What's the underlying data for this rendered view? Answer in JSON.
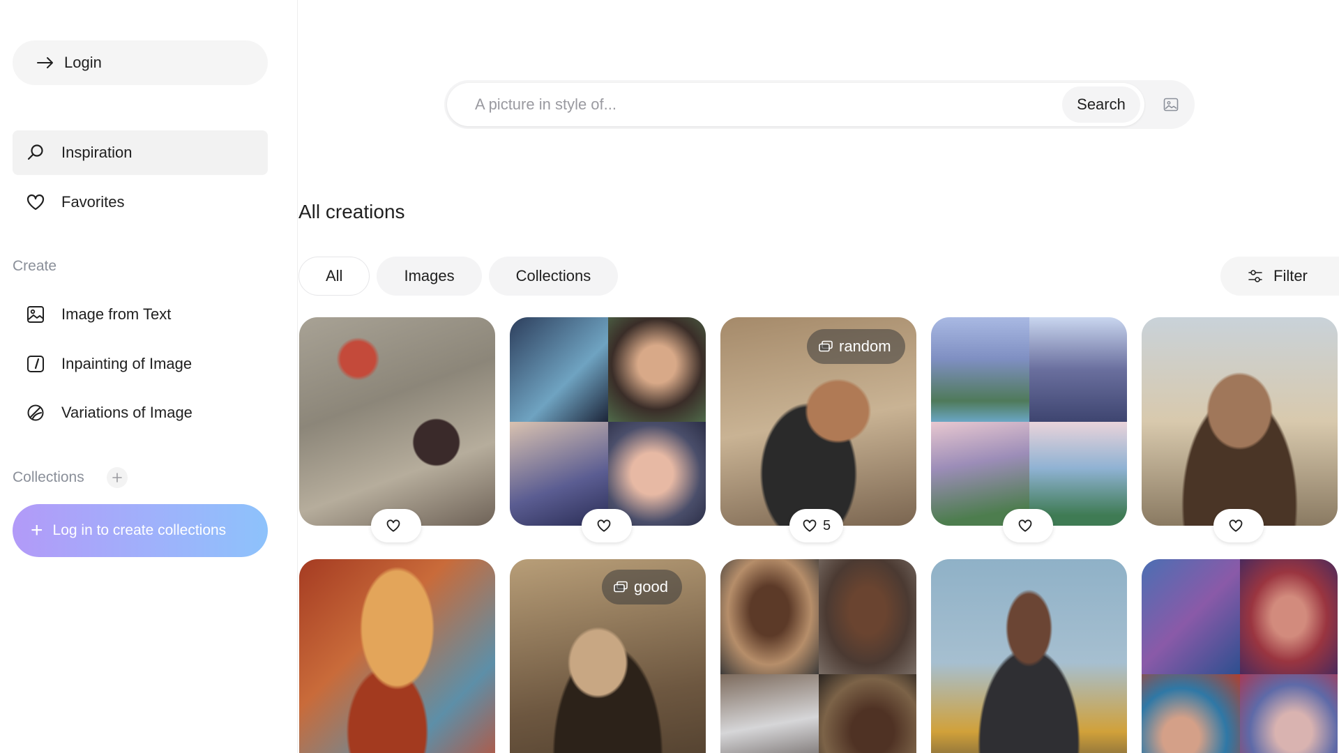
{
  "sidebar": {
    "login_label": "Login",
    "nav": [
      {
        "label": "Inspiration",
        "icon": "search-icon",
        "active": true
      },
      {
        "label": "Favorites",
        "icon": "heart-icon",
        "active": false
      }
    ],
    "create_section_label": "Create",
    "create_items": [
      {
        "label": "Image from Text",
        "icon": "image-icon"
      },
      {
        "label": "Inpainting of Image",
        "icon": "inpaint-icon"
      },
      {
        "label": "Variations of Image",
        "icon": "variations-icon"
      }
    ],
    "collections_section_label": "Collections",
    "create_collections_label": "Log in to create collections"
  },
  "search": {
    "placeholder": "A picture in style of...",
    "button_label": "Search"
  },
  "main": {
    "title": "All creations",
    "tabs": [
      {
        "label": "All",
        "active": true
      },
      {
        "label": "Images",
        "active": false
      },
      {
        "label": "Collections",
        "active": false
      }
    ],
    "filter_label": "Filter"
  },
  "cards": [
    {
      "badge": "",
      "likes": ""
    },
    {
      "badge": "",
      "likes": ""
    },
    {
      "badge": "random",
      "likes": "5"
    },
    {
      "badge": "",
      "likes": ""
    },
    {
      "badge": "",
      "likes": ""
    },
    {
      "badge": "",
      "likes": ""
    },
    {
      "badge": "good",
      "likes": ""
    },
    {
      "badge": "",
      "likes": ""
    },
    {
      "badge": "",
      "likes": ""
    },
    {
      "badge": "",
      "likes": ""
    }
  ],
  "colors": {
    "accent_gradient_start": "#b29af8",
    "accent_gradient_end": "#8dc2fb",
    "muted_text": "#8a8f99",
    "active_nav_bg": "#f2f2f2"
  }
}
